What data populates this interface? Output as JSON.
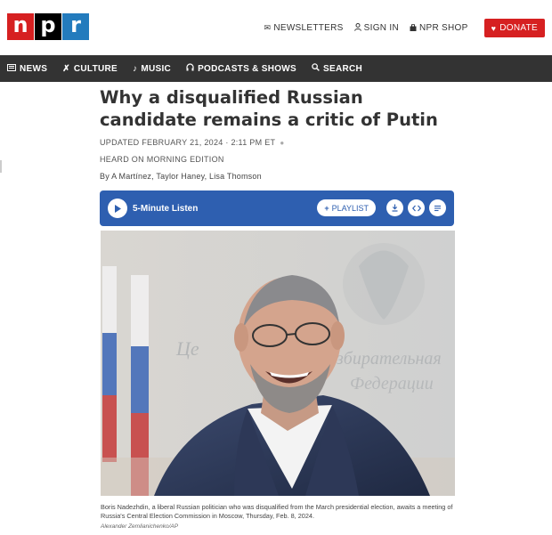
{
  "header": {
    "logo": [
      "n",
      "p",
      "r"
    ],
    "links": [
      {
        "label": "NEWSLETTERS",
        "icon": "envelope-icon"
      },
      {
        "label": "SIGN IN",
        "icon": "user-icon"
      },
      {
        "label": "NPR SHOP",
        "icon": "bag-icon"
      }
    ],
    "donate_label": "DONATE",
    "donate_icon": "heart-icon"
  },
  "nav": [
    {
      "label": "NEWS",
      "icon": "newspaper-icon"
    },
    {
      "label": "CULTURE",
      "icon": "culture-icon"
    },
    {
      "label": "MUSIC",
      "icon": "music-note-icon"
    },
    {
      "label": "PODCASTS & SHOWS",
      "icon": "headphones-icon"
    },
    {
      "label": "SEARCH",
      "icon": "search-icon"
    }
  ],
  "article": {
    "headline": "Why a disqualified Russian candidate remains a critic of Putin",
    "updated": "UPDATED FEBRUARY 21, 2024 · 2:11 PM ET",
    "heard_on": "HEARD ON MORNING EDITION",
    "byline": "By A Martínez, Taylor Haney, Lisa Thomson"
  },
  "player": {
    "listen_label": "5-Minute Listen",
    "playlist_label": "PLAYLIST",
    "accent": "#2e5fb0"
  },
  "photo": {
    "caption": "Boris Nadezhdin, a liberal Russian politician who was disqualified from the March presidential election, awaits a meeting of Russia's Central Election Commission in Moscow, Thursday, Feb. 8, 2024.",
    "credit": "Alexander Zemlianichenko/AP"
  },
  "colors": {
    "brand_red": "#d62021",
    "brand_blue": "#237bbd",
    "nav_bg": "#333333"
  }
}
